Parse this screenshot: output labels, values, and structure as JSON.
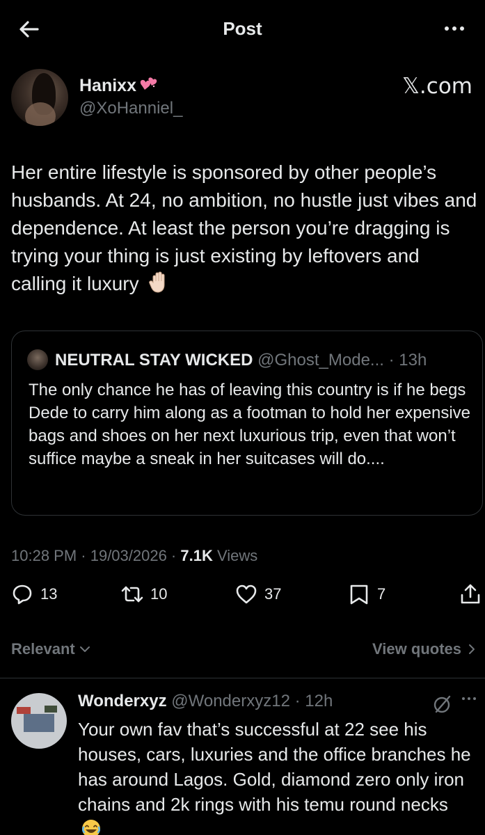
{
  "header": {
    "title": "Post"
  },
  "post": {
    "author_name": "Hanixx",
    "author_handle": "@XoHanniel_",
    "watermark": "𝕏.com",
    "text": "Her entire lifestyle is sponsored by other people’s husbands. At 24, no ambition, no hustle just vibes and dependence. At least the person you’re dragging is trying your thing is just existing by leftovers and calling it luxury",
    "timestamp": "10:28 PM · 19/03/2026 · ",
    "views_count": "7.1K",
    "views_label": " Views"
  },
  "quote": {
    "name": "NEUTRAL STAY WICKED",
    "meta": " @Ghost_Mode... · 13h",
    "text": "The only chance he has of leaving this country is if he begs Dede to carry him along as a footman to hold her expensive bags and shoes on her next luxurious trip, even that won’t suffice maybe a sneak in her suitcases will do...."
  },
  "actions": {
    "replies": "13",
    "reposts": "10",
    "likes": "37",
    "bookmarks": "7"
  },
  "filters": {
    "sort_label": "Relevant",
    "view_quotes_label": "View quotes"
  },
  "reply": {
    "name": "Wonderxyz",
    "meta": " @Wonderxyz12 · 12h",
    "text": "Your own fav that’s successful at 22 see his houses, cars, luxuries and the office branches he has around Lagos. Gold, diamond zero only iron chains and 2k rings with his temu round necks"
  },
  "icons": {
    "back": "arrow-left-icon",
    "more": "more-dots-icon",
    "heart_emoji": "two-hearts-emoji",
    "hand_emoji": "raised-hand-emoji",
    "reply": "reply-icon",
    "repost": "repost-icon",
    "like": "heart-icon",
    "bookmark": "bookmark-icon",
    "share": "share-icon",
    "grok": "grok-icon",
    "laugh_emoji": "laughing-emoji"
  },
  "colors": {
    "background": "#000000",
    "text": "#e7e9ea",
    "secondary": "#71767b",
    "border": "#2f3336",
    "heart_emoji": "#f47aa6"
  }
}
